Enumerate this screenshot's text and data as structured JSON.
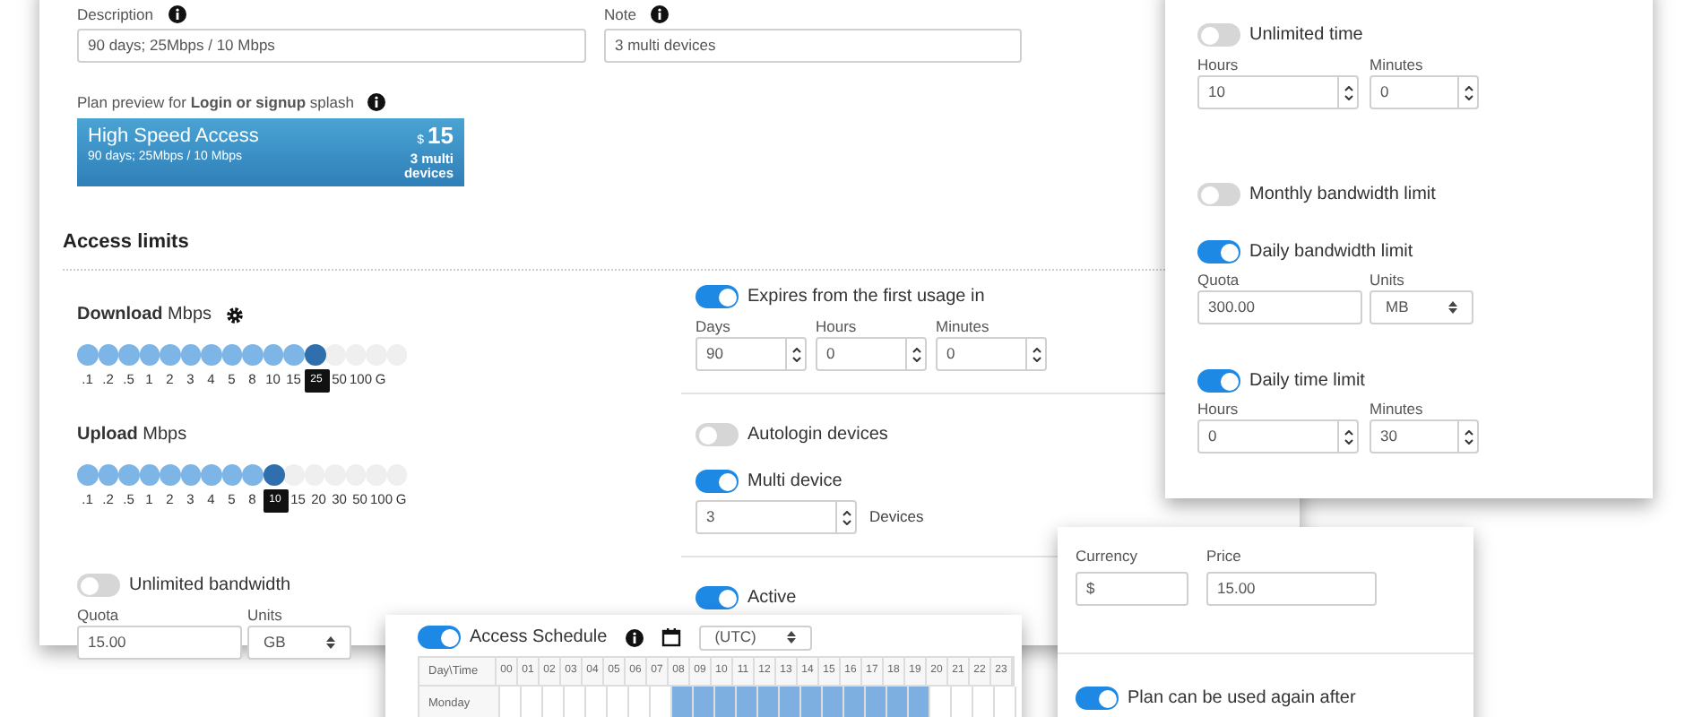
{
  "description": {
    "label": "Description",
    "value": "90 days; 25Mbps / 10 Mbps"
  },
  "note": {
    "label": "Note",
    "value": "3 multi devices"
  },
  "preview": {
    "label": "Plan preview for **Login or signup** splash",
    "title": "High Speed Access",
    "subtitle": "90 days; 25Mbps / 10 Mbps",
    "currency": "$",
    "price": "15",
    "devices": "3 multi devices"
  },
  "access_limits": {
    "title": "Access limits",
    "sliders": [
      {
        "label": "**Download** Mbps",
        "has_settings": true,
        "level": 0.733,
        "ticks": [
          {
            "kind": "tick",
            "label": ".1"
          },
          {
            "kind": "tick",
            "label": ".2"
          },
          {
            "kind": "tick",
            "label": ".5"
          },
          {
            "kind": "tick",
            "label": "1"
          },
          {
            "kind": "tick",
            "label": "2"
          },
          {
            "kind": "tick",
            "label": "3"
          },
          {
            "kind": "tick",
            "label": "4"
          },
          {
            "kind": "tick",
            "label": "5"
          },
          {
            "kind": "tick",
            "label": "8"
          },
          {
            "kind": "tick",
            "label": "10"
          },
          {
            "kind": "tick",
            "label": "15"
          },
          {
            "kind": "value",
            "label": "25"
          },
          {
            "kind": "tick",
            "label": "50"
          },
          {
            "kind": "tick",
            "label": "100"
          },
          {
            "kind": "tick",
            "label": "G"
          }
        ]
      },
      {
        "label": "**Upload** Mbps",
        "has_settings": false,
        "level": 0.6,
        "ticks": [
          {
            "kind": "tick",
            "label": ".1"
          },
          {
            "kind": "tick",
            "label": ".2"
          },
          {
            "kind": "tick",
            "label": ".5"
          },
          {
            "kind": "tick",
            "label": "1"
          },
          {
            "kind": "tick",
            "label": "2"
          },
          {
            "kind": "tick",
            "label": "3"
          },
          {
            "kind": "tick",
            "label": "4"
          },
          {
            "kind": "tick",
            "label": "5"
          },
          {
            "kind": "tick",
            "label": "8"
          },
          {
            "kind": "value",
            "label": "10"
          },
          {
            "kind": "tick",
            "label": "15"
          },
          {
            "kind": "tick",
            "label": "20"
          },
          {
            "kind": "tick",
            "label": "30"
          },
          {
            "kind": "tick",
            "label": "50"
          },
          {
            "kind": "tick",
            "label": "100"
          },
          {
            "kind": "tick",
            "label": "G"
          }
        ]
      }
    ],
    "unlimited_bandwidth": {
      "label": "Unlimited bandwidth",
      "on": false
    },
    "quota": {
      "label": "Quota",
      "value": "15.00"
    },
    "units": {
      "label": "Units",
      "value": "GB"
    },
    "expires": {
      "label": "Expires from the first usage in",
      "on": true,
      "fields": [
        {
          "label": "Days",
          "value": "90"
        },
        {
          "label": "Hours",
          "value": "0"
        },
        {
          "label": "Minutes",
          "value": "0"
        }
      ]
    },
    "autologin": {
      "label": "Autologin devices",
      "on": false
    },
    "multi_device": {
      "label": "Multi device",
      "on": true,
      "value": "3",
      "unit": "Devices"
    },
    "active": {
      "label": "Active",
      "on": true
    }
  },
  "time_panel": {
    "unlimited_time": {
      "label": "Unlimited time",
      "on": false
    },
    "time_fields": [
      {
        "label": "Hours",
        "value": "10"
      },
      {
        "label": "Minutes",
        "value": "0"
      }
    ],
    "monthly": {
      "label": "Monthly bandwidth limit",
      "on": false
    },
    "daily_bandwidth": {
      "label": "Daily bandwidth limit",
      "on": true
    },
    "quota": {
      "label": "Quota",
      "value": "300.00"
    },
    "units": {
      "label": "Units",
      "value": "MB"
    },
    "daily_time": {
      "label": "Daily time limit",
      "on": true
    },
    "daily_fields": [
      {
        "label": "Hours",
        "value": "0"
      },
      {
        "label": "Minutes",
        "value": "30"
      }
    ]
  },
  "price_panel": {
    "currency": {
      "label": "Currency",
      "value": "$"
    },
    "price": {
      "label": "Price",
      "value": "15.00"
    },
    "reuse": {
      "label": "Plan can be used again after",
      "on": true
    }
  },
  "schedule": {
    "label": "Access Schedule",
    "on": true,
    "timezone": "(UTC)",
    "corner": "Day\\Time",
    "hours": [
      "00",
      "01",
      "02",
      "03",
      "04",
      "05",
      "06",
      "07",
      "08",
      "09",
      "10",
      "11",
      "12",
      "13",
      "14",
      "15",
      "16",
      "17",
      "18",
      "19",
      "20",
      "21",
      "22",
      "23"
    ],
    "rows": [
      {
        "day": "Monday",
        "slots": [
          false,
          false,
          false,
          false,
          false,
          false,
          false,
          false,
          true,
          true,
          true,
          true,
          true,
          true,
          true,
          true,
          true,
          true,
          true,
          true,
          false,
          false,
          false,
          false
        ]
      }
    ]
  }
}
